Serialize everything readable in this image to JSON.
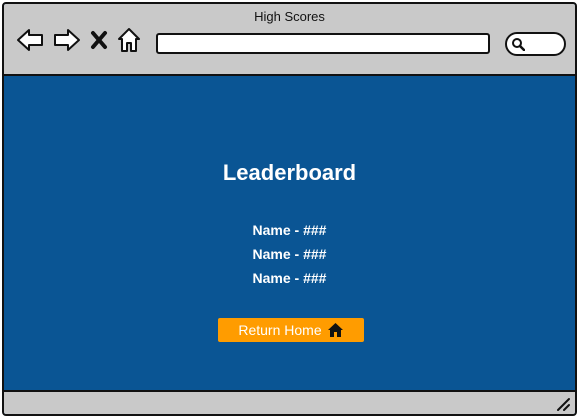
{
  "window": {
    "title": "High Scores"
  },
  "toolbar": {
    "back_icon": "arrow-left-icon",
    "forward_icon": "arrow-right-icon",
    "stop_icon": "close-icon",
    "home_icon": "home-icon",
    "address_value": "",
    "search_value": "",
    "search_icon": "search-icon"
  },
  "main": {
    "heading": "Leaderboard",
    "scores": [
      {
        "label": "Name - ###"
      },
      {
        "label": "Name - ###"
      },
      {
        "label": "Name - ###"
      }
    ],
    "return_button": {
      "label": "Return Home",
      "icon": "home-icon"
    }
  },
  "colors": {
    "background": "#0a5594",
    "chrome": "#c9c9c9",
    "button": "#ff9c00",
    "text": "#ffffff"
  }
}
